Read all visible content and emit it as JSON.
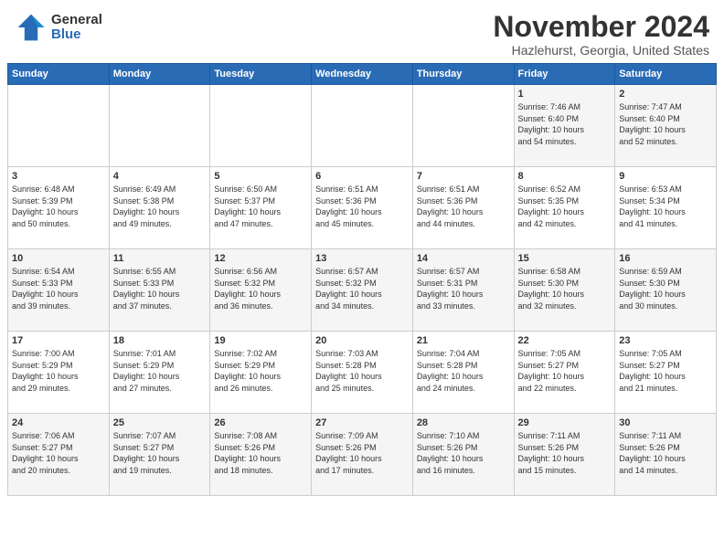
{
  "header": {
    "logo_general": "General",
    "logo_blue": "Blue",
    "month": "November 2024",
    "location": "Hazlehurst, Georgia, United States"
  },
  "days_of_week": [
    "Sunday",
    "Monday",
    "Tuesday",
    "Wednesday",
    "Thursday",
    "Friday",
    "Saturday"
  ],
  "weeks": [
    [
      {
        "day": "",
        "info": ""
      },
      {
        "day": "",
        "info": ""
      },
      {
        "day": "",
        "info": ""
      },
      {
        "day": "",
        "info": ""
      },
      {
        "day": "",
        "info": ""
      },
      {
        "day": "1",
        "info": "Sunrise: 7:46 AM\nSunset: 6:40 PM\nDaylight: 10 hours\nand 54 minutes."
      },
      {
        "day": "2",
        "info": "Sunrise: 7:47 AM\nSunset: 6:40 PM\nDaylight: 10 hours\nand 52 minutes."
      }
    ],
    [
      {
        "day": "3",
        "info": "Sunrise: 6:48 AM\nSunset: 5:39 PM\nDaylight: 10 hours\nand 50 minutes."
      },
      {
        "day": "4",
        "info": "Sunrise: 6:49 AM\nSunset: 5:38 PM\nDaylight: 10 hours\nand 49 minutes."
      },
      {
        "day": "5",
        "info": "Sunrise: 6:50 AM\nSunset: 5:37 PM\nDaylight: 10 hours\nand 47 minutes."
      },
      {
        "day": "6",
        "info": "Sunrise: 6:51 AM\nSunset: 5:36 PM\nDaylight: 10 hours\nand 45 minutes."
      },
      {
        "day": "7",
        "info": "Sunrise: 6:51 AM\nSunset: 5:36 PM\nDaylight: 10 hours\nand 44 minutes."
      },
      {
        "day": "8",
        "info": "Sunrise: 6:52 AM\nSunset: 5:35 PM\nDaylight: 10 hours\nand 42 minutes."
      },
      {
        "day": "9",
        "info": "Sunrise: 6:53 AM\nSunset: 5:34 PM\nDaylight: 10 hours\nand 41 minutes."
      }
    ],
    [
      {
        "day": "10",
        "info": "Sunrise: 6:54 AM\nSunset: 5:33 PM\nDaylight: 10 hours\nand 39 minutes."
      },
      {
        "day": "11",
        "info": "Sunrise: 6:55 AM\nSunset: 5:33 PM\nDaylight: 10 hours\nand 37 minutes."
      },
      {
        "day": "12",
        "info": "Sunrise: 6:56 AM\nSunset: 5:32 PM\nDaylight: 10 hours\nand 36 minutes."
      },
      {
        "day": "13",
        "info": "Sunrise: 6:57 AM\nSunset: 5:32 PM\nDaylight: 10 hours\nand 34 minutes."
      },
      {
        "day": "14",
        "info": "Sunrise: 6:57 AM\nSunset: 5:31 PM\nDaylight: 10 hours\nand 33 minutes."
      },
      {
        "day": "15",
        "info": "Sunrise: 6:58 AM\nSunset: 5:30 PM\nDaylight: 10 hours\nand 32 minutes."
      },
      {
        "day": "16",
        "info": "Sunrise: 6:59 AM\nSunset: 5:30 PM\nDaylight: 10 hours\nand 30 minutes."
      }
    ],
    [
      {
        "day": "17",
        "info": "Sunrise: 7:00 AM\nSunset: 5:29 PM\nDaylight: 10 hours\nand 29 minutes."
      },
      {
        "day": "18",
        "info": "Sunrise: 7:01 AM\nSunset: 5:29 PM\nDaylight: 10 hours\nand 27 minutes."
      },
      {
        "day": "19",
        "info": "Sunrise: 7:02 AM\nSunset: 5:29 PM\nDaylight: 10 hours\nand 26 minutes."
      },
      {
        "day": "20",
        "info": "Sunrise: 7:03 AM\nSunset: 5:28 PM\nDaylight: 10 hours\nand 25 minutes."
      },
      {
        "day": "21",
        "info": "Sunrise: 7:04 AM\nSunset: 5:28 PM\nDaylight: 10 hours\nand 24 minutes."
      },
      {
        "day": "22",
        "info": "Sunrise: 7:05 AM\nSunset: 5:27 PM\nDaylight: 10 hours\nand 22 minutes."
      },
      {
        "day": "23",
        "info": "Sunrise: 7:05 AM\nSunset: 5:27 PM\nDaylight: 10 hours\nand 21 minutes."
      }
    ],
    [
      {
        "day": "24",
        "info": "Sunrise: 7:06 AM\nSunset: 5:27 PM\nDaylight: 10 hours\nand 20 minutes."
      },
      {
        "day": "25",
        "info": "Sunrise: 7:07 AM\nSunset: 5:27 PM\nDaylight: 10 hours\nand 19 minutes."
      },
      {
        "day": "26",
        "info": "Sunrise: 7:08 AM\nSunset: 5:26 PM\nDaylight: 10 hours\nand 18 minutes."
      },
      {
        "day": "27",
        "info": "Sunrise: 7:09 AM\nSunset: 5:26 PM\nDaylight: 10 hours\nand 17 minutes."
      },
      {
        "day": "28",
        "info": "Sunrise: 7:10 AM\nSunset: 5:26 PM\nDaylight: 10 hours\nand 16 minutes."
      },
      {
        "day": "29",
        "info": "Sunrise: 7:11 AM\nSunset: 5:26 PM\nDaylight: 10 hours\nand 15 minutes."
      },
      {
        "day": "30",
        "info": "Sunrise: 7:11 AM\nSunset: 5:26 PM\nDaylight: 10 hours\nand 14 minutes."
      }
    ]
  ]
}
